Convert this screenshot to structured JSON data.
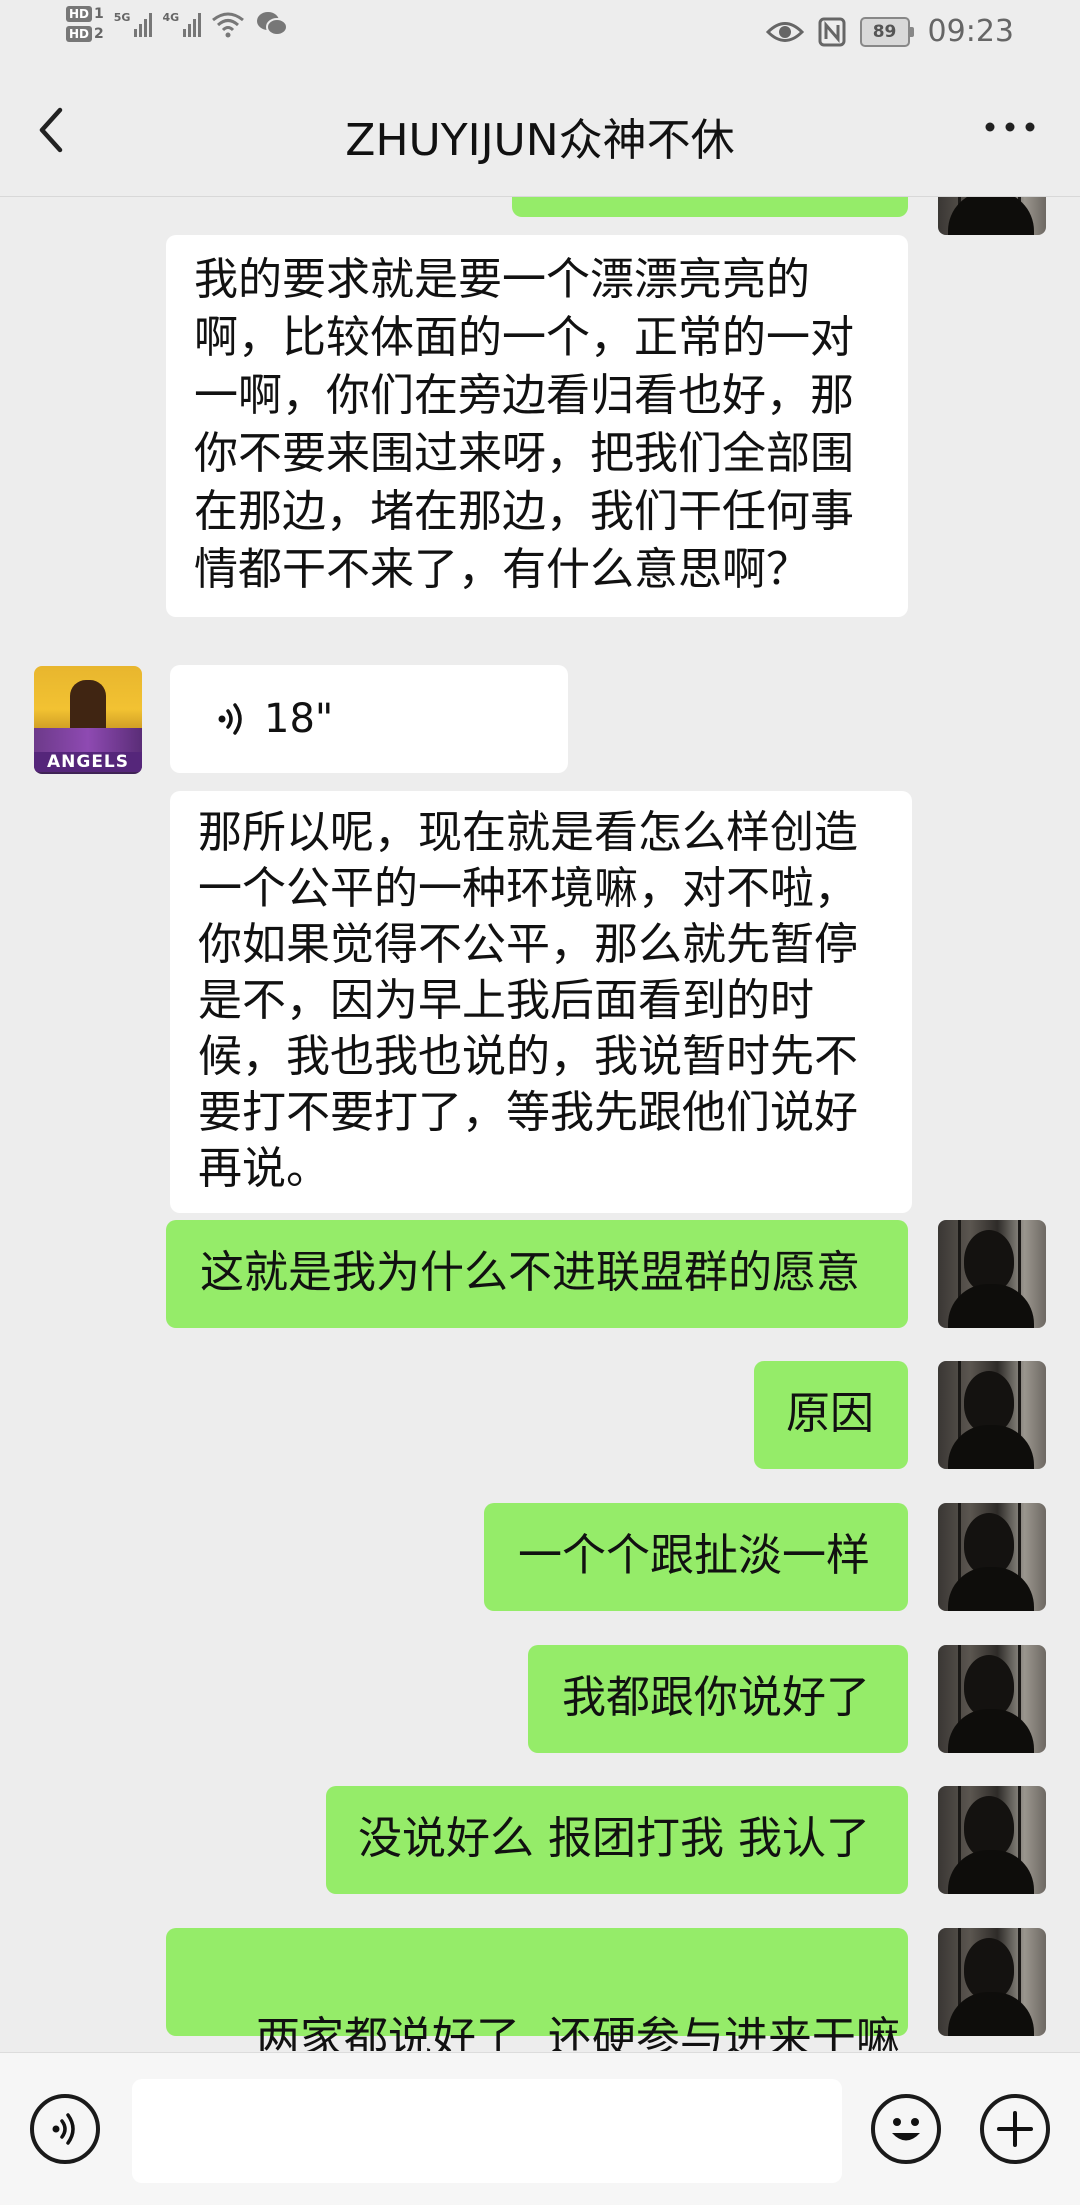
{
  "status_bar": {
    "hd1": "HD",
    "hd1_num": "1",
    "hd2": "HD",
    "hd2_num": "2",
    "signal1_label": "5G",
    "signal2_label": "4G",
    "battery": "89",
    "time": "09:23"
  },
  "header": {
    "title": "ZHUYIJUN众神不休"
  },
  "messages": {
    "m1": "我的要求就是要一个漂漂亮亮的啊，比较体面的一个，正常的一对一啊，你们在旁边看归看也好，那你不要来围过来呀，把我们全部围在那边，堵在那边，我们干任何事情都干不来了，有什么意思啊？",
    "m2_voice": "18\"",
    "m3": "那所以呢，现在就是看怎么样创造一个公平的一种环境嘛，对不啦，你如果觉得不公平，那么就先暂停是不，因为早上我后面看到的时候，我也我也说的，我说暂时先不要打不要打了，等我先跟他们说好再说。",
    "m4": "这就是我为什么不进联盟群的愿意",
    "m5": "原因",
    "m6": "一个个跟扯淡一样",
    "m7": "我都跟你说好了",
    "m8": "没说好么 报团打我 我认了",
    "m9": "两家都说好了  还硬参与进来干嘛"
  },
  "other_avatar_text": "ANGELS",
  "input": {
    "value": ""
  },
  "colors": {
    "background": "#ededed",
    "sent_bubble": "#95ec69",
    "received_bubble": "#ffffff"
  },
  "icons": [
    "back-icon",
    "more-icon",
    "voice-toggle-icon",
    "emoji-icon",
    "plus-icon",
    "voice-wave-icon",
    "eye-icon",
    "nfc-icon",
    "wifi-icon",
    "wechat-icon"
  ]
}
